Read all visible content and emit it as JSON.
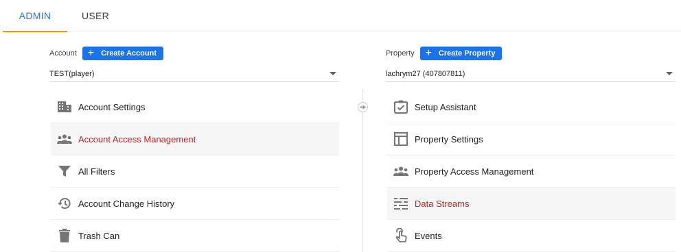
{
  "tabs": [
    {
      "label": "ADMIN",
      "active": true
    },
    {
      "label": "USER",
      "active": false
    }
  ],
  "account": {
    "label": "Account",
    "create_label": "Create Account",
    "selected": "TEST(player)",
    "menu": [
      {
        "label": "Account Settings",
        "icon": "building-icon"
      },
      {
        "label": "Account Access Management",
        "icon": "people-icon",
        "active": true
      },
      {
        "label": "All Filters",
        "icon": "filter-icon"
      },
      {
        "label": "Account Change History",
        "icon": "history-icon"
      },
      {
        "label": "Trash Can",
        "icon": "trash-icon"
      }
    ]
  },
  "property": {
    "label": "Property",
    "create_label": "Create Property",
    "selected": "lachrym27 (407807811)",
    "menu": [
      {
        "label": "Setup Assistant",
        "icon": "checklist-icon"
      },
      {
        "label": "Property Settings",
        "icon": "layout-icon"
      },
      {
        "label": "Property Access Management",
        "icon": "people-icon"
      },
      {
        "label": "Data Streams",
        "icon": "streams-icon",
        "active": true
      },
      {
        "label": "Events",
        "icon": "touch-icon"
      }
    ]
  },
  "colors": {
    "accent": "#1a73e8",
    "tab_indicator": "#f29900",
    "active_text": "#c5221f",
    "icon": "#757575"
  }
}
